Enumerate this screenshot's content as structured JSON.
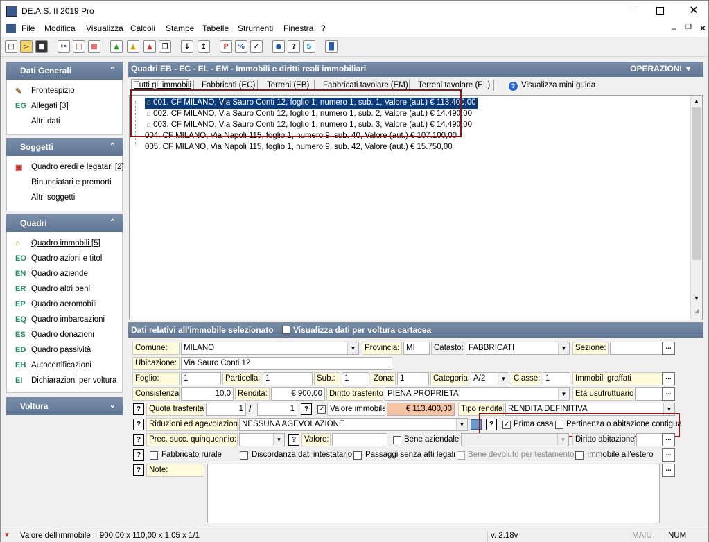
{
  "app": {
    "title": "DE.A.S. II 2019 Pro"
  },
  "menu": [
    "File",
    "Modifica",
    "Visualizza",
    "Calcoli",
    "Stampe",
    "Tabelle",
    "Strumenti",
    "Finestra",
    "?"
  ],
  "sidebar": {
    "dati_generali": {
      "title": "Dati Generali",
      "items": [
        {
          "prefix": "",
          "label": "Frontespizio",
          "icon": "pen-icon"
        },
        {
          "prefix": "EG",
          "label": "Allegati [3]"
        },
        {
          "prefix": "",
          "label": "Altri dati"
        }
      ]
    },
    "soggetti": {
      "title": "Soggetti",
      "items": [
        {
          "prefix": "",
          "label": "Quadro eredi e legatari [2]",
          "icon": "gift-icon"
        },
        {
          "prefix": "",
          "label": "Rinunciatari e premorti"
        },
        {
          "prefix": "",
          "label": "Altri soggetti"
        }
      ]
    },
    "quadri": {
      "title": "Quadri",
      "items": [
        {
          "prefix": "",
          "label": "Quadro immobili [5]",
          "icon": "house-icon"
        },
        {
          "prefix": "EO",
          "label": "Quadro azioni e titoli"
        },
        {
          "prefix": "EN",
          "label": "Quadro aziende"
        },
        {
          "prefix": "ER",
          "label": "Quadro altri beni"
        },
        {
          "prefix": "EP",
          "label": "Quadro aeromobili"
        },
        {
          "prefix": "EQ",
          "label": "Quadro imbarcazioni"
        },
        {
          "prefix": "ES",
          "label": "Quadro donazioni"
        },
        {
          "prefix": "ED",
          "label": "Quadro passività"
        },
        {
          "prefix": "EH",
          "label": "Autocertificazioni"
        },
        {
          "prefix": "EI",
          "label": "Dichiarazioni per voltura"
        }
      ]
    },
    "voltura": {
      "title": "Voltura"
    }
  },
  "main": {
    "title": "Quadri EB - EC - EL - EM - Immobili e diritti reali immobiliari",
    "operations": "OPERAZIONI",
    "tabs": [
      "Tutti gli immobili",
      "Fabbricati (EC)",
      "Terreni (EB)",
      "Fabbricati tavolare (EM)",
      "Terreni tavolare (EL)"
    ],
    "guide": "Visualizza mini guida",
    "properties": [
      "001. CF MILANO, Via Sauro Conti 12, foglio 1, numero 1, sub. 1, Valore (aut.) € 113.400,00",
      "002. CF MILANO, Via Sauro Conti 12, foglio 1, numero 1, sub. 2, Valore (aut.) € 14.490,00",
      "003. CF MILANO, Via Sauro Conti 12, foglio 1, numero 1, sub. 3, Valore (aut.) € 14.490,00",
      "004. CF MILANO, Via Napoli 115, foglio 1, numero 9, sub. 40, Valore (aut.) € 107.100,00",
      "005. CF MILANO, Via Napoli 115, foglio 1, numero 9, sub. 42, Valore (aut.) € 15.750,00"
    ]
  },
  "detail": {
    "title": "Dati relativi all'immobile selezionato",
    "voltura_label": "Visualizza dati per voltura cartacea",
    "comune_label": "Comune:",
    "comune": "MILANO",
    "provincia_label": "Provincia:",
    "provincia": "MI",
    "catasto_label": "Catasto:",
    "catasto": "FABBRICATI",
    "sezione_label": "Sezione:",
    "ubicazione_label": "Ubicazione:",
    "ubicazione": "Via Sauro Conti 12",
    "foglio_label": "Foglio:",
    "foglio": "1",
    "particella_label": "Particella:",
    "particella": "1",
    "sub_label": "Sub.:",
    "sub": "1",
    "zona_label": "Zona:",
    "zona": "1",
    "categoria_label": "Categoria:",
    "categoria": "A/2",
    "classe_label": "Classe:",
    "classe": "1",
    "immobili_graffati": "Immobili graffati",
    "consistenza_label": "Consistenza:",
    "consistenza": "10,0",
    "rendita_label": "Rendita:",
    "rendita": "€ 900,00",
    "diritto_label": "Diritto trasferito:",
    "diritto": "PIENA PROPRIETA'",
    "eta_label": "Età usufruttuario:",
    "quota_label": "Quota trasferita:",
    "quota_num": "1",
    "quota_den": "1",
    "valore_label": "Valore immobile:",
    "valore": "€ 113.400,00",
    "tipo_rendita_label": "Tipo rendita:",
    "tipo_rendita": "RENDITA DEFINITIVA",
    "riduzioni_label": "Riduzioni ed agevolazioni:",
    "riduzioni": "NESSUNA AGEVOLAZIONE",
    "prima_casa": "Prima casa",
    "pertinenza": "Pertinenza o abitazione contigua",
    "prec_label": "Prec. succ. quinquennio:",
    "valore2_label": "Valore:",
    "bene_aziendale": "Bene aziendale",
    "diritto_abitazione": "Diritto abitazione:",
    "fabbricato_rurale": "Fabbricato rurale",
    "discordanza": "Discordanza dati intestatario",
    "passaggi": "Passaggi senza atti legali",
    "bene_devoluto": "Bene devoluto per testamento",
    "immobile_estero": "Immobile all'estero",
    "note_label": "Note:"
  },
  "status": {
    "formula": "Valore dell'immobile = 900,00 x 110,00 x 1,05 x 1/1",
    "version": "v. 2.18v",
    "caps": "MAIU",
    "num": "NUM"
  },
  "colors": {
    "header": "#6a809e",
    "selected": "#0a3a7a",
    "highlight": "#8b1a1a",
    "label_bg": "#fffbdb",
    "valore_bg": "#f4c4a4"
  }
}
